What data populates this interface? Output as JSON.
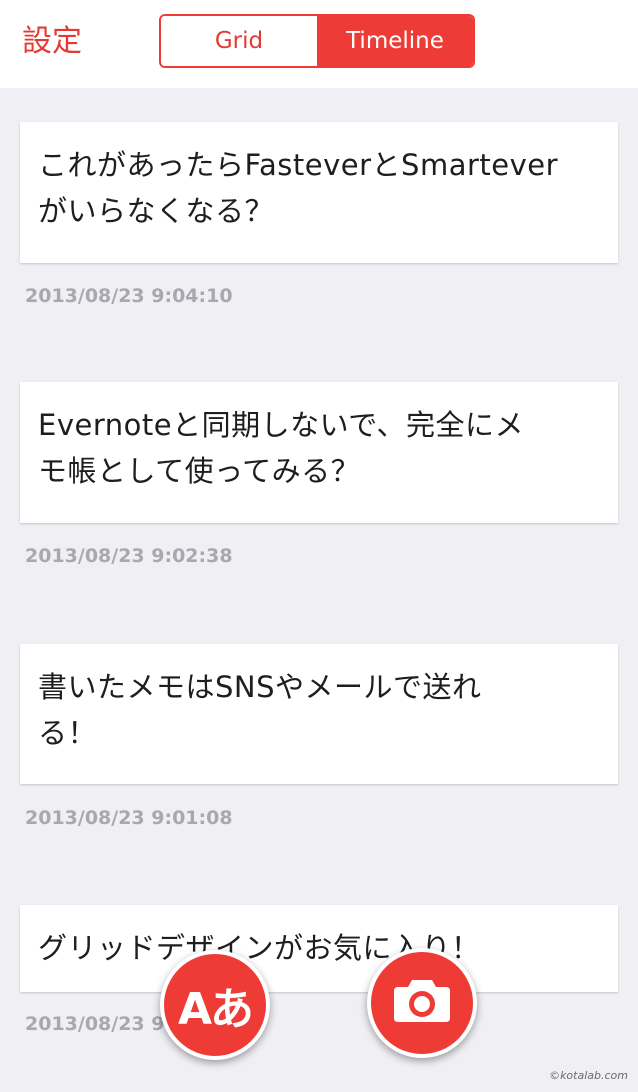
{
  "header": {
    "settings_label": "設定",
    "tabs": [
      {
        "label": "Grid",
        "active": false
      },
      {
        "label": "Timeline",
        "active": true
      }
    ]
  },
  "notes": [
    {
      "text": "これがあったらFasteverとSmartever\nがいらなくなる？",
      "timestamp": "2013/08/23 9:04:10"
    },
    {
      "text": "Evernoteと同期しないで、完全にメ\nモ帳として使ってみる？",
      "timestamp": "2013/08/23 9:02:38"
    },
    {
      "text": "書いたメモはSNSやメールで送れ\nる！",
      "timestamp": "2013/08/23 9:01:08"
    },
    {
      "text": "グリッドデザインがお気に入り！",
      "timestamp": "2013/08/23 9:00:04"
    }
  ],
  "actions": {
    "text_button_label": "Aあ",
    "camera_icon": "camera-icon"
  },
  "watermark": "©kotalab.com",
  "colors": {
    "accent": "#ef3b36",
    "background": "#efeff4",
    "timestamp": "#a8a8ae"
  }
}
